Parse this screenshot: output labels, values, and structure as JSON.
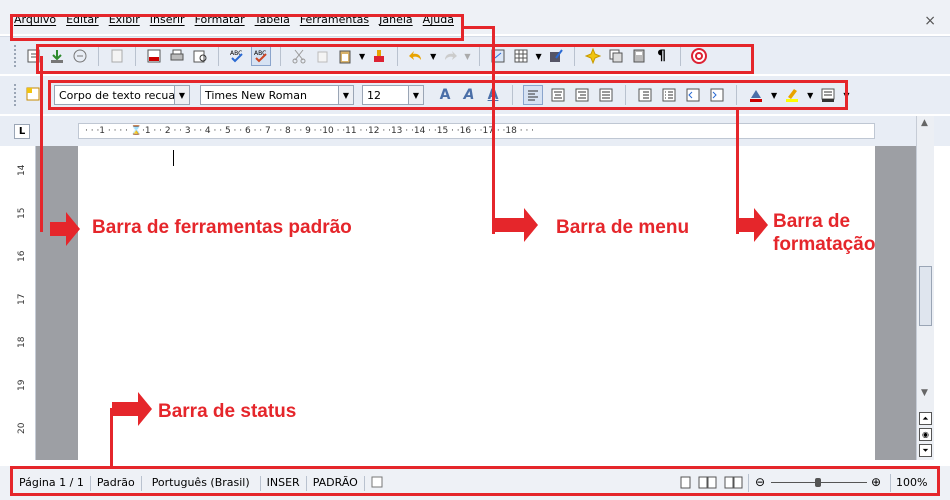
{
  "menu": {
    "items": [
      "Arquivo",
      "Editar",
      "Exibir",
      "Inserir",
      "Formatar",
      "Tabela",
      "Ferramentas",
      "Janela",
      "Ajuda"
    ],
    "close_glyph": "×"
  },
  "formatting": {
    "style_value": "Corpo de texto recuad",
    "font_value": "Times New Roman",
    "size_value": "12"
  },
  "ruler": {
    "text": "· · ·1 · · ·   · ⌛·1 · · 2 · · 3 · · 4 · · 5 · · 6 · · 7 · · 8 · · 9 · ·10 · ·11 · ·12 · ·13 · ·14 · ·15 · ·16 · ·17 · ·18 · · ·",
    "tab_button": "L",
    "vertical_marks": [
      "14",
      "15",
      "16",
      "17",
      "18",
      "19",
      "20"
    ]
  },
  "status": {
    "page": "Página 1 / 1",
    "style": "Padrão",
    "language": "Português (Brasil)",
    "insert": "INSER",
    "selection": "PADRÃO",
    "zoom": "100%"
  },
  "annotations": {
    "standard": "Barra de ferramentas padrão",
    "menu": "Barra de menu",
    "formatting": "Barra de formatação",
    "status": "Barra de status"
  },
  "colors": {
    "annotation": "#e5262b"
  }
}
